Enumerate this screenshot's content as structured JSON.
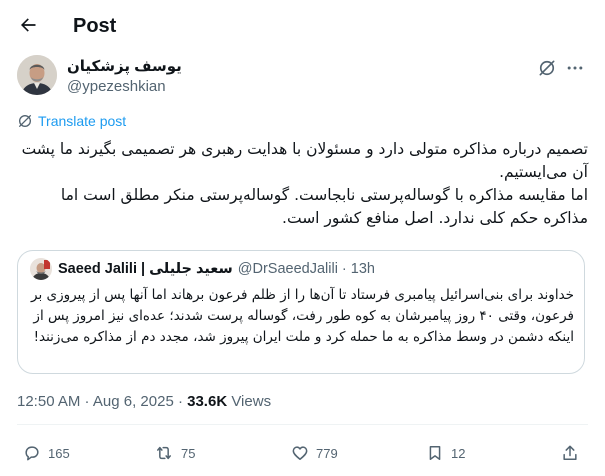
{
  "header": {
    "title": "Post",
    "back_icon": "arrow-left-icon"
  },
  "author": {
    "name": "یوسف پزشکیان",
    "handle": "@ypezeshkian",
    "avatar_icon": "profile-photo",
    "grok_icon": "grok-icon",
    "more_icon": "more-dots-icon"
  },
  "translate": {
    "label": "Translate post",
    "icon": "globe-icon"
  },
  "post": {
    "lines": [
      "تصمیم درباره مذاکره متولی دارد و مسئولان با هدایت رهبری هر تصمیمی بگیرند ما پشت آن می‌ایستیم.",
      "اما مقایسه مذاکره با گوساله‌پرستی نابجاست. گوساله‌پرستی منکر مطلق است اما مذاکره حکم کلی ندارد. اصل منافع کشور است."
    ]
  },
  "quote": {
    "name": "Saeed Jalili | سعید جلیلی",
    "handle": "@DrSaeedJalili",
    "separator": "·",
    "time": "13h",
    "text": "خداوند برای بنی‌اسرائیل پیامبری فرستاد تا آن‌ها را از ظلم فرعون برهاند اما آنها پس از پیروزی بر فرعون، وقتی ۴۰ روز پیامبرشان به کوه طور رفت، گوساله پرست شدند؛ عده‌ای نیز امروز پس از اینکه دشمن در وسط مذاکره به ما حمله کرد و ملت ایران پیروز شد، مجدد دم از مذاکره می‌زنند!"
  },
  "meta": {
    "datetime": "12:50 AM · Aug 6, 2025 · ",
    "views_count": "33.6K",
    "views_label": " Views"
  },
  "actions": {
    "replies": "165",
    "reposts": "75",
    "likes": "779",
    "bookmarks": "12"
  },
  "colors": {
    "accent": "#1d9bf0",
    "text": "#0f1419",
    "secondary": "#536471",
    "border": "#cfd9de"
  }
}
